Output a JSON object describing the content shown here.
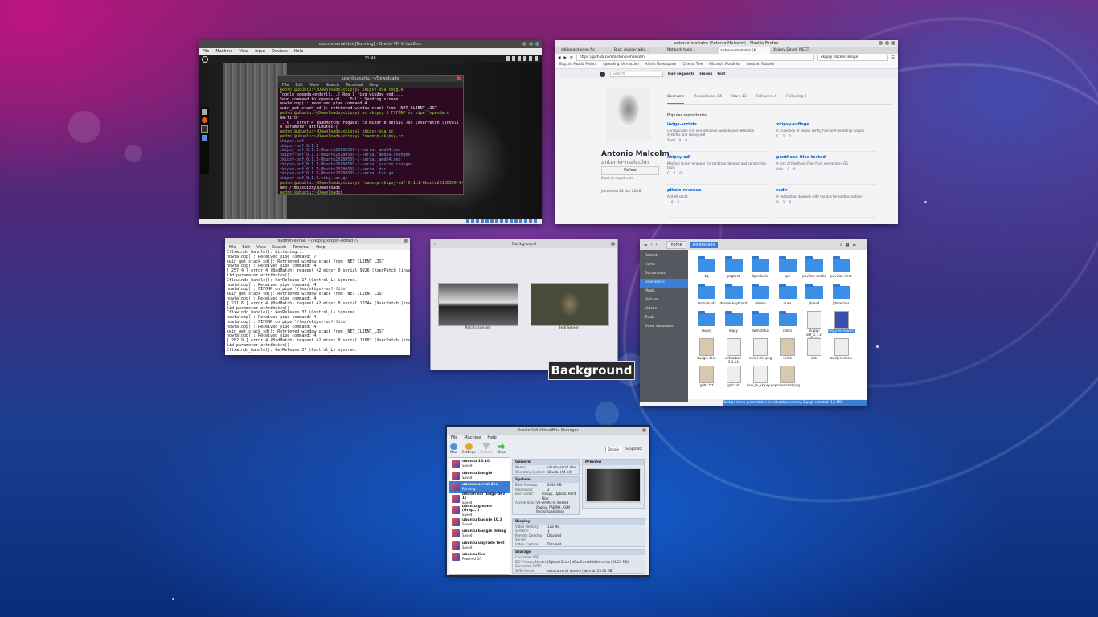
{
  "overlay_label": "Background",
  "windows": {
    "vbox_vm": {
      "title": "ubuntu serial dev [Running] - Oracle VM VirtualBox",
      "menu": [
        "File",
        "Machine",
        "View",
        "Input",
        "Devices",
        "Help"
      ],
      "clock": "21:40",
      "inner_terminal": {
        "title": "user@ubuntu: ~/Downloads",
        "menu": [
          "File",
          "Edit",
          "View",
          "Search",
          "Terminal",
          "Help"
        ],
        "lines": [
          {
            "c": "g",
            "t": "pedrol@ubuntu:~/Downloads/xkipsy$ xkipsy-oda-toggle"
          },
          {
            "c": "w",
            "t": "Toggle xpenda-ondorl[...] Reg 1 ring window end...."
          },
          {
            "c": "w",
            "t": "Send command to xpenda-ol... Full: Sending screen..."
          },
          {
            "c": "w",
            "t": "nowtaloop(): received pipe command 4"
          },
          {
            "c": "w",
            "t": "xwin_get_stack_sd(): retrieved window stack from _NET_CLIENT_LIST"
          },
          {
            "c": "g",
            "t": "pedrol@ubuntu:~/Downloads/xkipsy$ nc xkipsy 8 FIFONP nc pipe /xpendaro"
          },
          {
            "c": "w",
            "t": "da-fifo\""
          },
          {
            "c": "w",
            "t": "       .. 0 ] error 4 (BadMatch) request to minor 8 serial 769 (XserPatch (invali"
          },
          {
            "c": "w",
            "t": "d parameter attributes))"
          },
          {
            "c": "g",
            "t": "pedrol@ubuntu:~/Downloads/xkipsy$ xkipsy-oda cc"
          },
          {
            "c": "g",
            "t": "pedrol@ubuntu:~/Downloads/xkipsy$ fsadmtp-xkipsy-rc"
          },
          {
            "c": "b",
            "t": "xkipsy.odf"
          },
          {
            "c": "b",
            "t": "xkipsy-odf-0.1.1"
          },
          {
            "c": "b",
            "t": "xkipsy_odf_0.1.1-Ubuntu20180509-1-serial_amd64.deb"
          },
          {
            "c": "b",
            "t": "xkipsy-odf_0.1.1-Ubuntu20180509-1-serial_amd64.changes"
          },
          {
            "c": "b",
            "t": "xkipsy-odf_0.1.1-Ubuntu20180509-1-serial_amd64.deb"
          },
          {
            "c": "b",
            "t": "xkipsy-odf_0.1.1-Ubuntu20180509-1-serial_source.changes"
          },
          {
            "c": "b",
            "t": "xkipsy-odf_0.1.1-Ubuntu20180509-1-serial.dsc"
          },
          {
            "c": "b",
            "t": "xkipsy-odf_0.1.1-Ubuntu20180509-1-serial.tar.gz"
          },
          {
            "c": "b",
            "t": "xkipsy-odf_0.1.1.orig.tar.gz"
          },
          {
            "c": "g",
            "t": "pedrol@ubuntu:~/Downloads/xkipsy$ fsadmtp-xkipsy-odf 0.1.1-Ubuntu20180509-1-serial_amd64"
          },
          {
            "c": "w",
            "t": "deb /tmp/xkipsy/Downloads"
          },
          {
            "c": "g",
            "t": "pedrol@ubuntu:~/Downloads$ "
          }
        ]
      }
    },
    "firefox": {
      "title": "antonio-malcolm (Antonio Malcolm) - Mozilla Firefox",
      "tabs": [
        "sdkiqoard-odeo fix",
        "Bug: xkipsy/radio...",
        "Network tools...",
        "antonio-malcolm (A...",
        "Xkipsy Devel: MEET"
      ],
      "url": "https://github.com/antonio-malcolm",
      "search": "xkipsy docker image",
      "bookmarks": [
        "Bug List Mozilla Fedora",
        "Spreading Ohm action",
        "Affairs Marketplace",
        "Cinema Tree",
        "Microsoft Wordlinks",
        "Rentrok: Rubbish"
      ],
      "gh_nav": [
        "Pull requests",
        "Issues",
        "Gist"
      ],
      "gh_search": "Search",
      "profile_name": "Antonio Malcolm",
      "profile_login": "antonio-malcolm",
      "follow_btn": "Follow",
      "block_link": "Block or report user",
      "joined": "Joined on 22 Jun 2016",
      "profile_tabs": [
        "Overview",
        "Repositories 14",
        "Stars 13",
        "Followers 4",
        "Following 0"
      ],
      "popular_heading": "Popular repositories",
      "repos": [
        {
          "name": "lodge-scripts",
          "desc": "Configurable and non-intrusive audio-based detection systems and xkipsy-odf",
          "lang": "Shell",
          "stars": "0",
          "forks": "0"
        },
        {
          "name": "xkipsy-sofinge",
          "desc": "A collection of xkipsy config files and bootstrap scripts",
          "lang": "C",
          "stars": "1",
          "forks": "0"
        },
        {
          "name": "xkipsy-odf",
          "desc": "Minimal xkipsy wrapper for scripting daemon and connecting tools",
          "lang": "C",
          "stars": "0",
          "forks": "0"
        },
        {
          "name": "pantheon-files-tested",
          "desc": "A fork of Pantheon Files from elementary OS",
          "lang": "Vala",
          "stars": "0",
          "forks": "0"
        },
        {
          "name": "pihole-revenue",
          "desc": "A shell script",
          "lang": "",
          "stars": "0",
          "forks": "0"
        },
        {
          "name": "redir",
          "desc": "A redirection daemon with various forwarding options",
          "lang": "C",
          "stars": "1",
          "forks": "0"
        }
      ]
    },
    "terminal2": {
      "title": "fsadmin-serial: ~/xkipsy/xkipsy-odfwd ??",
      "menu": [
        "File",
        "Edit",
        "View",
        "Search",
        "Terminal",
        "Help"
      ],
      "lines": [
        "Ctlxwindo_handle(): Listening...",
        "nowtaloop(): Received pipe command: 7",
        "xwin_get_stack_sd(): Retrieved window stack from _NET_CLIENT_LIST",
        "nowtaloop(): Received pipe command: 4",
        "[   257.4  ] error 4 (BadMatch) request 42 minor 0 serial 9926 (XserPatch (inva",
        "lid parameter attributes))",
        "Ctlxwindo_handle(): keyRelease 17 (Control_L) ignored.",
        "nowtaloop(): Received pipe command: 4",
        "nowtaloop(): FIFONP on pipe '/tmp/xkipsy-odf-fifo'",
        "xwin_get_stack_sd(): Retrieved window stack from _NET_CLIENT_LIST",
        "nowtaloop(): Received pipe command: 4",
        "[   271.6  ] error 4 (BadMatch) request 42 minor 0 serial 10344 (XserPatch (inva",
        "lid parameter attributes))",
        "Ctlxwindo_handle(): keyRelease 37 (Control_L) ignored.",
        "nowtaloop(): Received pipe command: 4",
        "nowtaloop(): FIFONP on pipe '/tmp/xkipsy-odf-fifo'",
        "nowtaloop(): Received pipe command: 4",
        "xwin_get_stack_sd(): Retrieved window stack from _NET_CLIENT_LIST",
        "nowtaloop(): Received pipe command: 4",
        "[   282.9  ] error 4 (BadMatch) request 42 minor 0 serial 11082 (XserPatch (inva",
        "lid parameter attributes))",
        "Ctlxwindo_handle(): keyRelease 37 (Control_L) ignored."
      ]
    },
    "background": {
      "title": "Background",
      "thumbs": [
        "Pacific sunset",
        "Jedi Senior"
      ]
    },
    "files": {
      "path": [
        "home",
        "Downloads"
      ],
      "sidebar": [
        "Recent",
        "Home",
        "Documents",
        "Downloads",
        "Music",
        "Pictures",
        "Videos",
        "Trash",
        "Other Locations"
      ],
      "items": [
        "bq",
        "pkgtest",
        "fglrx-build",
        "kpc",
        "pavilion-media",
        "pavilion-misc",
        "android-sdk",
        "dvorak-keyboard",
        "dmenu",
        "drwx",
        "jtimed",
        "jdmaclabs",
        "xkipsy",
        "lbqsy",
        "dwmstatus",
        "notes",
        "xkipsy-odf_0.1.1-Ubuntu",
        "lbqsy-tor-source",
        "budgie-tour",
        "virtualbox-5.1.14",
        "serial-dev.png",
        "ui.txt",
        "note",
        "budgie-menu",
        "gdbx.txt",
        "gdb.txt",
        "how_to_xkipsy.png",
        "screenshot.png"
      ],
      "status": "\"budgie-menu-presentation-in-virtualbox-running-2.png\" selected (1.3 MB)"
    },
    "vbox_manager": {
      "title": "Oracle VM VirtualBox Manager",
      "menu": [
        "File",
        "Machine",
        "Help"
      ],
      "toolbar": [
        "New",
        "Settings",
        "Discard",
        "Show"
      ],
      "right_tabs": [
        "Details",
        "Snapshots"
      ],
      "vms": [
        {
          "name": "ubuntu 16.10",
          "state": "Saved"
        },
        {
          "name": "ubuntu budgie",
          "state": "Saved"
        },
        {
          "name": "ubuntu serial dev",
          "state": "Running"
        },
        {
          "name": "debian sid (bugs-dev 1)",
          "state": "Saved"
        },
        {
          "name": "ubuntu gnome (Grap...)",
          "state": "Saved"
        },
        {
          "name": "ubuntu budgie 10.3",
          "state": "Saved"
        },
        {
          "name": "ubuntu budgie debug",
          "state": "Saved"
        },
        {
          "name": "ubuntu upgrade test",
          "state": "Saved"
        },
        {
          "name": "ubuntu live",
          "state": "Powered Off"
        }
      ],
      "general": {
        "title": "General",
        "rows": [
          [
            "Name:",
            "ubuntu serial dev"
          ],
          [
            "Operating System:",
            "Ubuntu (64-bit)"
          ]
        ]
      },
      "system": {
        "title": "System",
        "rows": [
          [
            "Base Memory:",
            "2048 MB"
          ],
          [
            "Processors:",
            "2"
          ],
          [
            "Boot Order:",
            "Floppy, Optical, Hard Disk"
          ],
          [
            "Acceleration:",
            "VT-x/AMD-V, Nested Paging, PAE/NX, KVM Paravirtualization"
          ]
        ]
      },
      "display": {
        "title": "Display",
        "rows": [
          [
            "Video Memory:",
            "128 MB"
          ],
          [
            "Screens:",
            "1"
          ],
          [
            "Remote Desktop Server:",
            "Disabled"
          ],
          [
            "Video Capture:",
            "Disabled"
          ]
        ]
      },
      "storage": {
        "title": "Storage",
        "rows": [
          [
            "Controller: IDE",
            ""
          ],
          [
            "IDE Primary Master:",
            "[Optical Drive] VBoxGuestAdditions.iso (56.27 MB)"
          ],
          [
            "Controller: SATA",
            ""
          ],
          [
            "SATA Port 0:",
            "ubuntu serial dev.vdi (Normal, 25.00 GB)"
          ]
        ]
      },
      "preview_title": "Preview"
    }
  }
}
